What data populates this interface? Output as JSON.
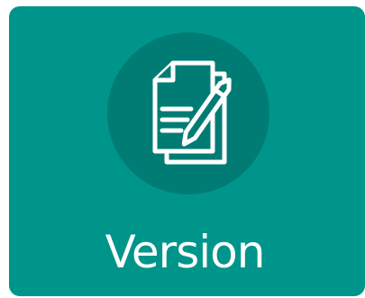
{
  "tile": {
    "label": "Version",
    "icon": "document-edit-icon"
  },
  "colors": {
    "tile_background": "#00958a",
    "icon_circle": "#017c74",
    "icon_stroke": "#ffffff",
    "label_text": "#ffffff"
  }
}
